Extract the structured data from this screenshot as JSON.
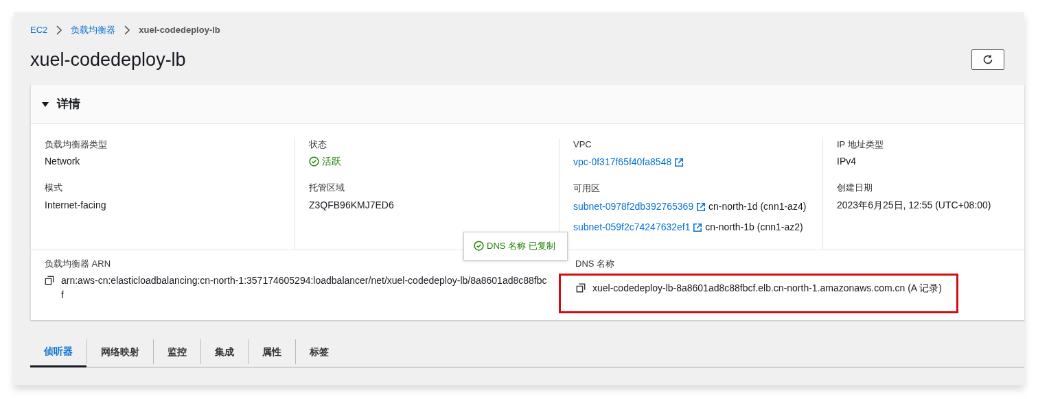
{
  "breadcrumb": [
    {
      "label": "EC2",
      "kind": "link"
    },
    {
      "label": "负载均衡器",
      "kind": "link"
    },
    {
      "label": "xuel-codedeploy-lb",
      "kind": "current"
    }
  ],
  "title": "xuel-codedeploy-lb",
  "details": {
    "heading": "详情",
    "expanded": true,
    "columns": [
      [
        {
          "label": "负载均衡器类型",
          "values": [
            {
              "kind": "text",
              "text": "Network"
            }
          ]
        },
        {
          "label": "模式",
          "values": [
            {
              "kind": "text",
              "text": "Internet-facing"
            }
          ]
        }
      ],
      [
        {
          "label": "状态",
          "values": [
            {
              "kind": "status",
              "text": "活跃"
            }
          ]
        },
        {
          "label": "托管区域",
          "values": [
            {
              "kind": "text",
              "text": "Z3QFB96KMJ7ED6"
            }
          ]
        }
      ],
      [
        {
          "label": "VPC",
          "values": [
            {
              "kind": "link",
              "text": "vpc-0f317f65f40fa8548"
            }
          ]
        },
        {
          "label": "可用区",
          "values": [
            {
              "kind": "link",
              "text": "subnet-0978f2db392765369",
              "suffix": "cn-north-1d (cnn1-az4)"
            },
            {
              "kind": "link",
              "text": "subnet-059f2c74247632ef1",
              "suffix": "cn-north-1b (cnn1-az2)"
            }
          ]
        }
      ],
      [
        {
          "label": "IP 地址类型",
          "values": [
            {
              "kind": "text",
              "text": "IPv4"
            }
          ]
        },
        {
          "label": "创建日期",
          "values": [
            {
              "kind": "text",
              "text": "2023年6月25日, 12:55 (UTC+08:00)"
            }
          ]
        }
      ]
    ],
    "arn": {
      "label": "负载均衡器 ARN",
      "value": "arn:aws-cn:elasticloadbalancing:cn-north-1:357174605294:loadbalancer/net/xuel-codedeploy-lb/8a8601ad8c88fbcf"
    },
    "dns": {
      "label": "DNS 名称",
      "value": "xuel-codedeploy-lb-8a8601ad8c88fbcf.elb.cn-north-1.amazonaws.com.cn (A 记录)",
      "highlighted": true
    },
    "tooltip": "DNS 名称 已复制"
  },
  "tabs": [
    {
      "label": "侦听器",
      "selected": true
    },
    {
      "label": "网络映射",
      "selected": false
    },
    {
      "label": "监控",
      "selected": false
    },
    {
      "label": "集成",
      "selected": false
    },
    {
      "label": "属性",
      "selected": false
    },
    {
      "label": "标签",
      "selected": false
    }
  ]
}
